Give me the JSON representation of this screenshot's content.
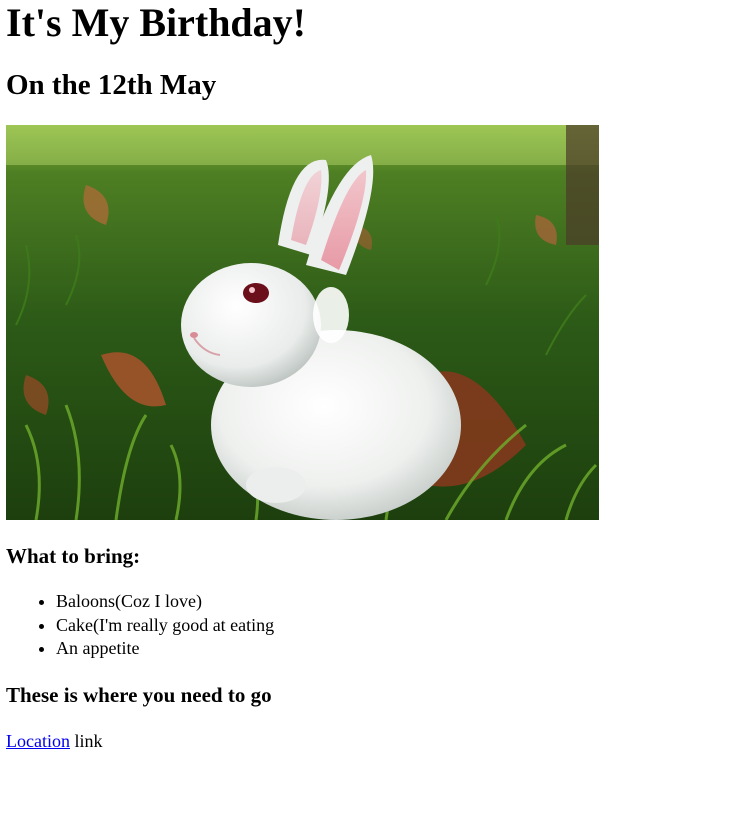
{
  "page": {
    "title": "It's My Birthday!",
    "date_heading": "On the 12th May",
    "bring_heading": "What to bring:",
    "bring_items": [
      "Baloons(Coz I love)",
      "Cake(I'm really good at eating",
      "An appetite"
    ],
    "location_heading": "These is where you need to go",
    "location_link_text": "Location",
    "location_suffix": "link"
  },
  "colors": {
    "link": "#0000ee",
    "text": "#000000",
    "background": "#ffffff"
  }
}
